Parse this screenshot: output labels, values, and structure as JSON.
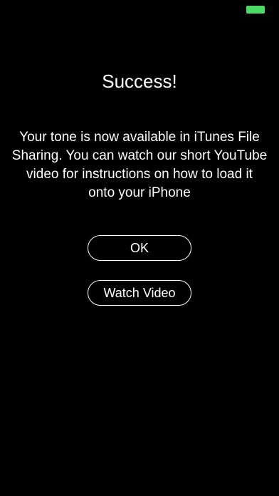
{
  "status_bar": {
    "battery_color": "#4cd964"
  },
  "dialog": {
    "title": "Success!",
    "message": "Your tone is now available in iTunes File Sharing.  You can watch our short YouTube video for instructions on how to load it onto your iPhone",
    "ok_label": "OK",
    "watch_video_label": "Watch Video"
  }
}
